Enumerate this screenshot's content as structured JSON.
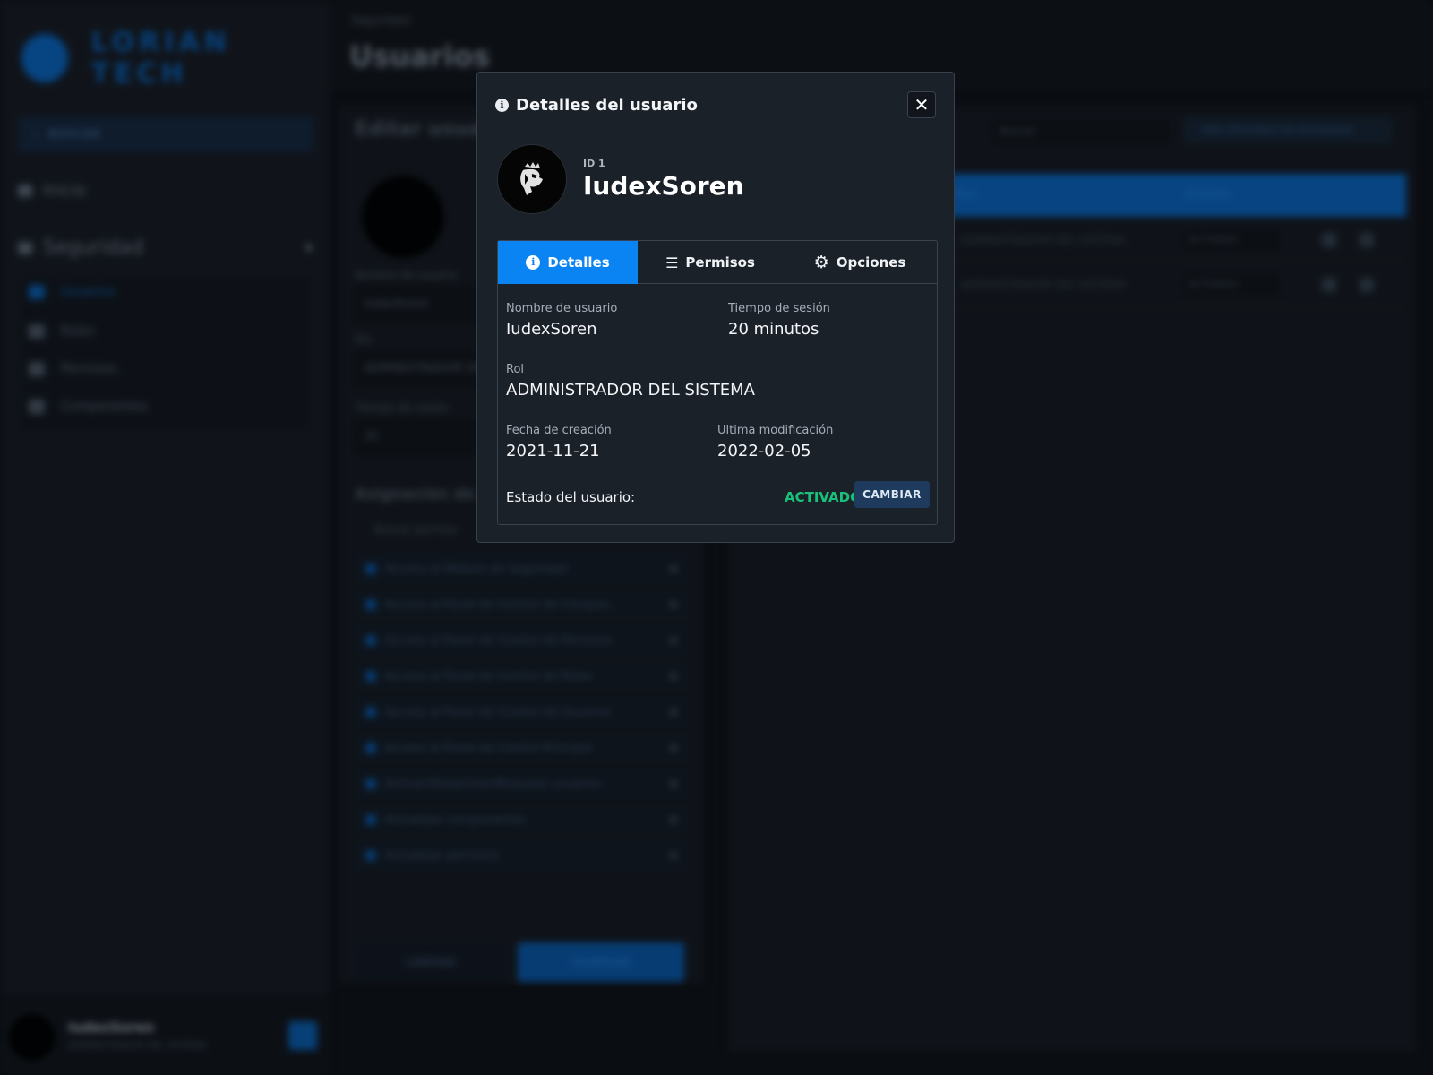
{
  "background": {
    "brand": "LORIAN TECH",
    "side_search": "BUSCAR",
    "nav_inicio": "Inicio",
    "nav_seguridad": "Seguridad",
    "nav_sub": [
      "Usuarios",
      "Roles",
      "Permisos",
      "Componentes"
    ],
    "footer_user": "IudexSoren",
    "footer_role": "ADMINISTRADOR DEL SISTEMA",
    "breadcrumb": "Seguridad",
    "page_title": "Usuarios",
    "edit_title": "Editar usuario",
    "lbl_username": "Nombre de usuario",
    "val_username": "IudexSoren",
    "lbl_rol": "Rol",
    "val_rol": "ADMINISTRADOR DEL SISTEMA",
    "lbl_tiempo": "Tiempo de sesión",
    "val_tiempo": "20",
    "perm_heading": "Asignación de permisos",
    "perm_search": "Buscar permiso",
    "perms": [
      "Acceso al Módulo de Seguridad",
      "Acceso al Panel de Control de Compon…",
      "Acceso al Panel de Control de Permisos",
      "Acceso al Panel de Control de Roles",
      "Acceso al Panel de Control de Usuarios",
      "Acceso al Panel de Control Principal",
      "Activar/Desactivar/Bloquear usuarios",
      "Actualizar componentes",
      "Actualizar permisos"
    ],
    "btn_limpiar": "LIMPIAR",
    "btn_guardar": "GUARDAR",
    "table_search": "Buscar",
    "table_filter": "MÁS OPCIONES DE BÚSQUEDA",
    "col_rol": "Rol",
    "col_estado": "Estado",
    "rows": [
      {
        "rol": "ADMINISTRADOR DEL SISTEMA",
        "estado": "ACTIVADO"
      },
      {
        "rol": "ADMINISTRADOR DEL SISTEMA",
        "estado": "ACTIVADO"
      }
    ]
  },
  "modal": {
    "title": "Detalles del usuario",
    "close": "✕",
    "id_label": "ID 1",
    "username": "IudexSoren",
    "tabs": {
      "detalles": "Detalles",
      "permisos": "Permisos",
      "opciones": "Opciones"
    },
    "fields": {
      "nombre_label": "Nombre de usuario",
      "nombre_value": "IudexSoren",
      "tiempo_label": "Tiempo de sesión",
      "tiempo_value": "20 minutos",
      "rol_label": "Rol",
      "rol_value": "ADMINISTRADOR DEL SISTEMA",
      "creacion_label": "Fecha de creación",
      "creacion_value": "2021-11-21",
      "modificacion_label": "Ultima modificación",
      "modificacion_value": "2022-02-05"
    },
    "status": {
      "label": "Estado del usuario:",
      "value": "ACTIVADO",
      "button": "CAMBIAR"
    }
  },
  "colors": {
    "accent": "#0b84f3",
    "status_active": "#19c17a",
    "modal_bg": "#1b2129"
  },
  "icons": [
    "info-icon",
    "close-icon",
    "list-icon",
    "gear-icon",
    "lion-avatar-icon"
  ]
}
